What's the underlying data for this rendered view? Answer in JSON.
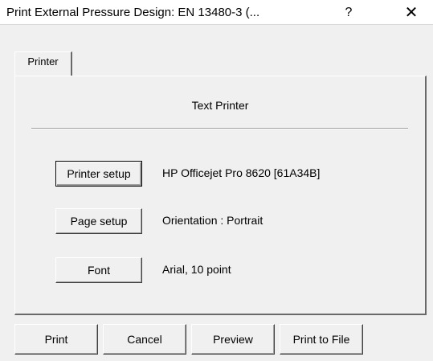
{
  "window": {
    "title": "Print External Pressure Design: EN 13480-3 (...",
    "help_glyph": "?",
    "close_glyph": "✕"
  },
  "tabs": [
    {
      "label": "Printer",
      "selected": true
    }
  ],
  "printer_panel": {
    "title": "Text Printer",
    "rows": [
      {
        "button_label": "Printer setup",
        "value": "HP Officejet Pro 8620 [61A34B]"
      },
      {
        "button_label": "Page setup",
        "value": "Orientation : Portrait"
      },
      {
        "button_label": "Font",
        "value": "Arial, 10 point"
      }
    ]
  },
  "footer": {
    "print_label": "Print",
    "cancel_label": "Cancel",
    "preview_label": "Preview",
    "print_to_file_label": "Print to File"
  },
  "colors": {
    "dialog_bg": "#f0f0f0",
    "titlebar_bg": "#ffffff"
  }
}
